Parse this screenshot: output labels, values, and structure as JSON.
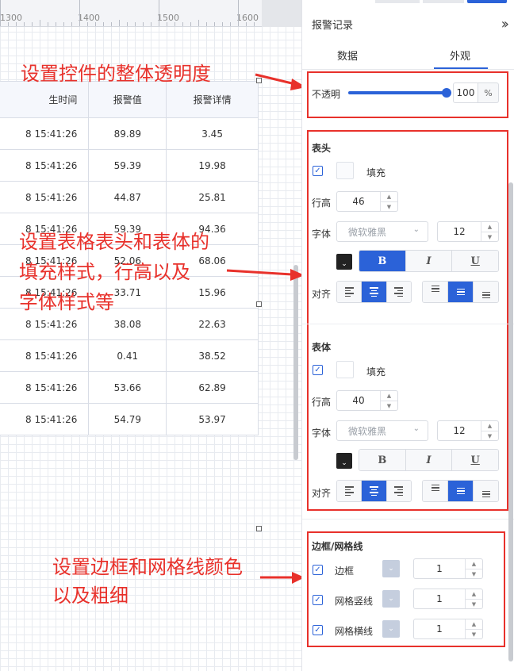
{
  "ruler": {
    "ticks": [
      "1300",
      "1400",
      "1500",
      "1600"
    ]
  },
  "table": {
    "headers": [
      "生时间",
      "报警值",
      "报警详情"
    ],
    "rows": [
      [
        "8 15:41:26",
        "89.89",
        "3.45"
      ],
      [
        "8 15:41:26",
        "59.39",
        "19.98"
      ],
      [
        "8 15:41:26",
        "44.87",
        "25.81"
      ],
      [
        "8 15:41:26",
        "59.39",
        "94.36"
      ],
      [
        "8 15:41:26",
        "52.06",
        "68.06"
      ],
      [
        "8 15:41:26",
        "33.71",
        "15.96"
      ],
      [
        "8 15:41:26",
        "38.08",
        "22.63"
      ],
      [
        "8 15:41:26",
        "0.41",
        "38.52"
      ],
      [
        "8 15:41:26",
        "53.66",
        "62.89"
      ],
      [
        "8 15:41:26",
        "54.79",
        "53.97"
      ]
    ]
  },
  "annotations": {
    "opacity": "设置控件的整体透明度",
    "style_line1": "设置表格表头和表体的",
    "style_line2": "填充样式，行高以及",
    "style_line3": "字体样式等",
    "border_line1": "设置边框和网格线颜色",
    "border_line2": "以及粗细"
  },
  "panel": {
    "title": "报警记录",
    "collapse_icon": "double-chevron-right-icon",
    "tabs": [
      "数据",
      "外观"
    ],
    "active_tab": "外观",
    "opacity": {
      "label": "不透明",
      "value": "100",
      "unit": "%",
      "level": 1.0
    },
    "header": {
      "section": "表头",
      "fill_label": "填充",
      "row_height_label": "行高",
      "row_height": "46",
      "font_label": "字体",
      "font_family": "微软雅黑",
      "font_size": "12",
      "bold": "B",
      "italic": "I",
      "underline": "U",
      "bold_active": true,
      "align_label": "对齐"
    },
    "body": {
      "section": "表体",
      "fill_label": "填充",
      "row_height_label": "行高",
      "row_height": "40",
      "font_label": "字体",
      "font_family": "微软雅黑",
      "font_size": "12",
      "bold": "B",
      "italic": "I",
      "underline": "U",
      "bold_active": false,
      "align_label": "对齐"
    },
    "border": {
      "section": "边框/网格线",
      "items": [
        {
          "label": "边框",
          "value": "1"
        },
        {
          "label": "网格竖线",
          "value": "1"
        },
        {
          "label": "网格横线",
          "value": "1"
        }
      ]
    }
  },
  "colors": {
    "accent": "#2b62d8",
    "annotation": "#e8312b"
  }
}
